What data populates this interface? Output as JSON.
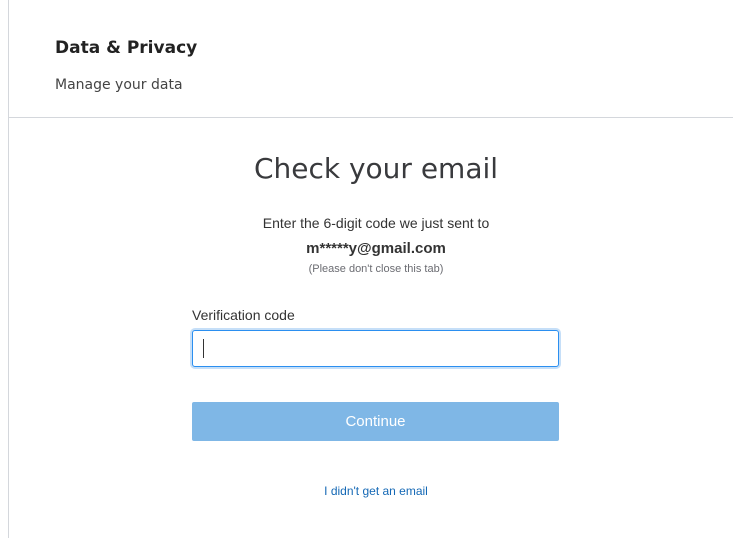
{
  "header": {
    "title": "Data & Privacy",
    "subtitle": "Manage your data"
  },
  "verify": {
    "heading": "Check your email",
    "instruction": "Enter the 6-digit code we just sent to",
    "email": "m*****y@gmail.com",
    "note": "(Please don't close this tab)",
    "field_label": "Verification code",
    "field_value": "",
    "continue_label": "Continue",
    "resend_link": "I didn't get an email"
  },
  "colors": {
    "button_bg": "#7fb7e6",
    "link": "#1468b5",
    "input_focus_border": "#2b8ff0"
  }
}
